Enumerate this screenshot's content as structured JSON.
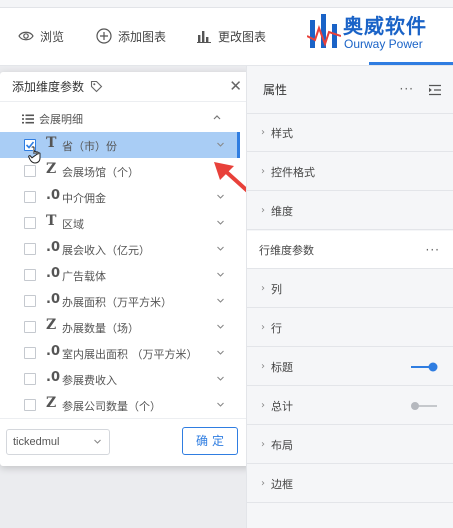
{
  "toolbar": {
    "items": [
      {
        "label": "浏览",
        "icon": "eye-icon"
      },
      {
        "label": "添加图表",
        "icon": "plus-circle-icon"
      },
      {
        "label": "更改图表",
        "icon": "bar-chart-icon"
      }
    ],
    "logo": {
      "cn": "奥威软件",
      "en": "Ourway Power",
      "color": "#1a63c7"
    }
  },
  "dimension_panel": {
    "title": "添加维度参数",
    "group": {
      "label": "会展明细"
    },
    "fields": [
      {
        "type_icon": "T",
        "label": "省（市）份",
        "checked": true,
        "selected": true
      },
      {
        "type_icon": "Z",
        "label": "会展场馆（个）",
        "checked": false,
        "selected": false
      },
      {
        "type_icon": ".0",
        "label": "中介佣金",
        "checked": false,
        "selected": false
      },
      {
        "type_icon": "T",
        "label": "区域",
        "checked": false,
        "selected": false
      },
      {
        "type_icon": ".0",
        "label": "展会收入（亿元）",
        "checked": false,
        "selected": false
      },
      {
        "type_icon": ".0",
        "label": "广告载体",
        "checked": false,
        "selected": false
      },
      {
        "type_icon": ".0",
        "label": "办展面积（万平方米）",
        "checked": false,
        "selected": false
      },
      {
        "type_icon": "Z",
        "label": "办展数量（场）",
        "checked": false,
        "selected": false
      },
      {
        "type_icon": ".0",
        "label": "室内展出面积 （万平方米）",
        "checked": false,
        "selected": false
      },
      {
        "type_icon": ".0",
        "label": "参展费收入",
        "checked": false,
        "selected": false
      },
      {
        "type_icon": "Z",
        "label": "参展公司数量（个）",
        "checked": false,
        "selected": false
      }
    ],
    "footer": {
      "select_value": "tickedmul",
      "ok_label": "确定"
    }
  },
  "property_panel": {
    "title": "属性",
    "rows": [
      {
        "label": "样式",
        "kind": "collapsed"
      },
      {
        "label": "控件格式",
        "kind": "collapsed"
      },
      {
        "label": "维度",
        "kind": "expanded"
      },
      {
        "label": "行维度参数",
        "kind": "sub"
      },
      {
        "label": "列",
        "kind": "collapsed"
      },
      {
        "label": "行",
        "kind": "collapsed"
      },
      {
        "label": "标题",
        "kind": "toggle",
        "toggle_on": true
      },
      {
        "label": "总计",
        "kind": "toggle",
        "toggle_on": false
      },
      {
        "label": "布局",
        "kind": "collapsed"
      },
      {
        "label": "边框",
        "kind": "collapsed"
      }
    ]
  },
  "colors": {
    "accent": "#2f7de1",
    "selected_row": "#a9cdf5",
    "annotation_arrow": "#e8413a"
  }
}
